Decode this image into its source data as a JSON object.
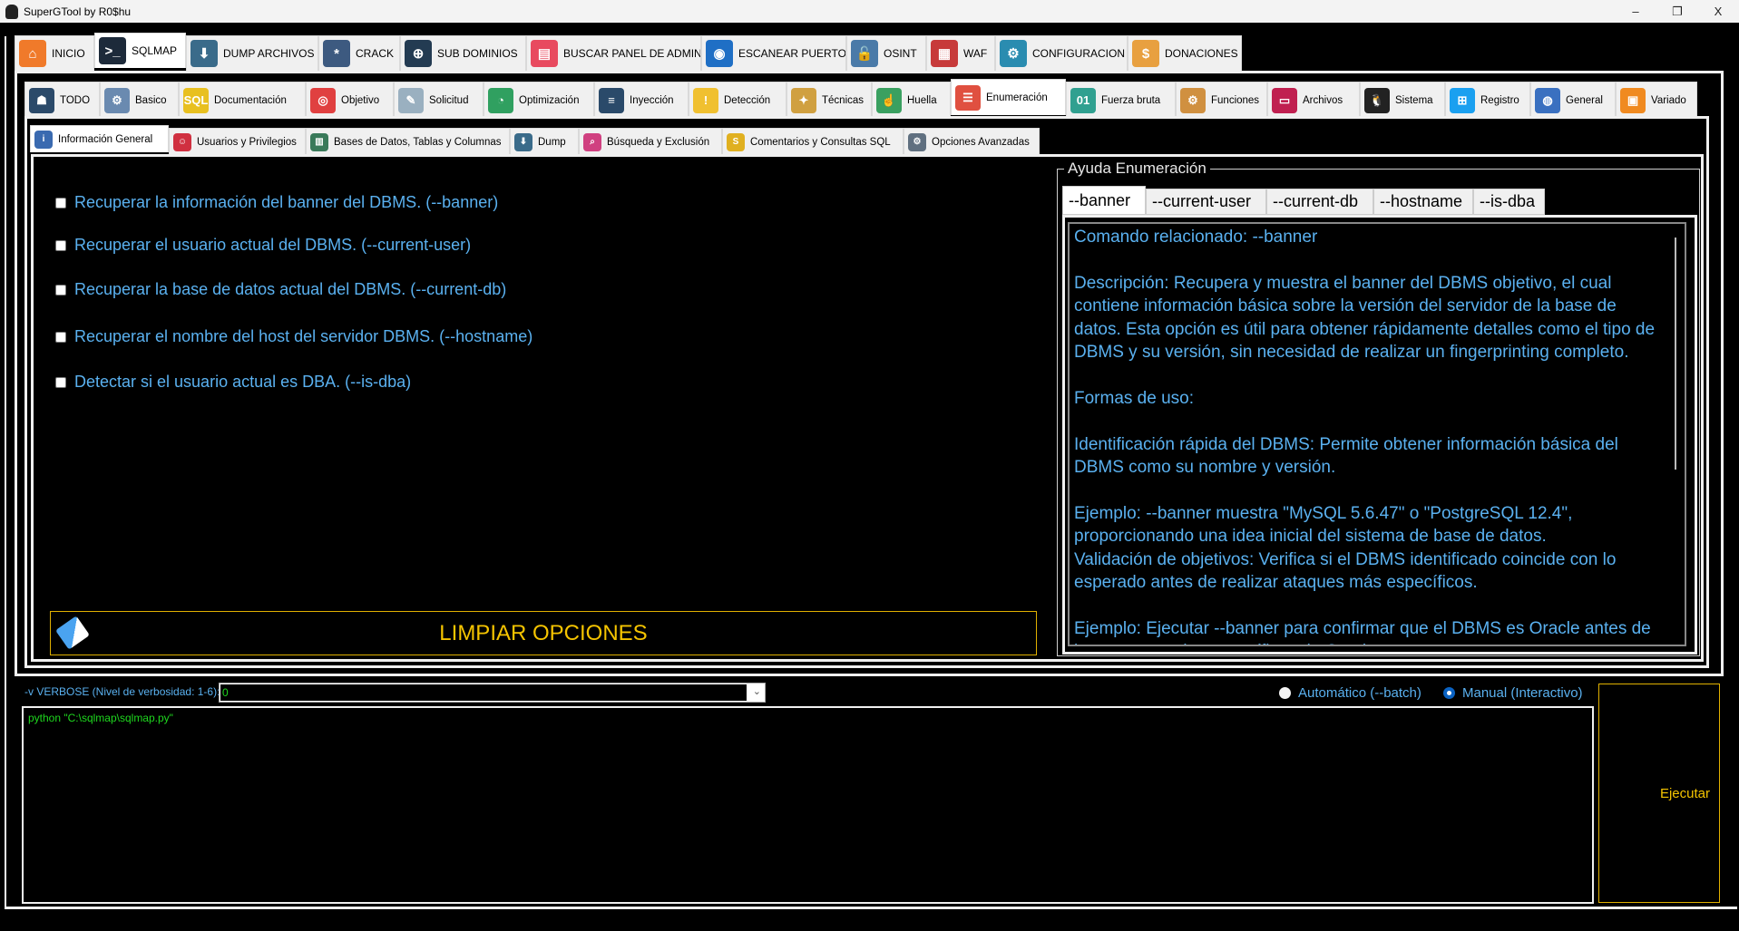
{
  "window": {
    "title": "SuperGTool by R0$hu",
    "minimize": "–",
    "maximize": "❐",
    "close": "X"
  },
  "main_tabs": [
    {
      "label": "INICIO",
      "icon": "home-icon",
      "color": "#f07a2a",
      "glyph": "⌂"
    },
    {
      "label": "SQLMAP",
      "icon": "terminal-icon",
      "color": "#1d2a3a",
      "glyph": ">_",
      "active": true
    },
    {
      "label": "DUMP ARCHIVOS",
      "icon": "database-download-icon",
      "color": "#3a6b8a",
      "glyph": "⬇"
    },
    {
      "label": "CRACK",
      "icon": "password-icon",
      "color": "#3d5a80",
      "glyph": "*"
    },
    {
      "label": "SUB DOMINIOS",
      "icon": "network-globe-icon",
      "color": "#233b52",
      "glyph": "⊕"
    },
    {
      "label": "BUSCAR PANEL DE ADMIN",
      "icon": "admin-panel-icon",
      "color": "#e84a5f",
      "glyph": "▤"
    },
    {
      "label": "ESCANEAR PUERTOS",
      "icon": "port-scan-icon",
      "color": "#1f6fc5",
      "glyph": "◉"
    },
    {
      "label": "OSINT",
      "icon": "unlock-icon",
      "color": "#4a7aa8",
      "glyph": "🔓"
    },
    {
      "label": "WAF",
      "icon": "firewall-icon",
      "color": "#c73a3a",
      "glyph": "▦"
    },
    {
      "label": "CONFIGURACION",
      "icon": "gear-icon",
      "color": "#2a8cb0",
      "glyph": "⚙"
    },
    {
      "label": "DONACIONES",
      "icon": "donate-icon",
      "color": "#e8a040",
      "glyph": "$"
    }
  ],
  "sub_tabs": [
    {
      "label": "TODO",
      "icon": "hacker-icon",
      "color": "#2b4a6a",
      "glyph": "☗"
    },
    {
      "label": "Basico",
      "icon": "robot-icon",
      "color": "#6a8ab0",
      "glyph": "⚙"
    },
    {
      "label": "Documentación",
      "icon": "sql-document-icon",
      "color": "#e8c020",
      "glyph": "SQL"
    },
    {
      "label": "Objetivo",
      "icon": "target-icon",
      "color": "#e04040",
      "glyph": "◎"
    },
    {
      "label": "Solicitud",
      "icon": "request-icon",
      "color": "#9ab0c0",
      "glyph": "✎"
    },
    {
      "label": "Optimización",
      "icon": "speedometer-icon",
      "color": "#30a060",
      "glyph": "◔"
    },
    {
      "label": "Inyección",
      "icon": "database-inject-icon",
      "color": "#2a4a6a",
      "glyph": "≡"
    },
    {
      "label": "Detección",
      "icon": "warning-search-icon",
      "color": "#f0c030",
      "glyph": "!"
    },
    {
      "label": "Técnicas",
      "icon": "lightbulb-gear-icon",
      "color": "#d0a040",
      "glyph": "✦"
    },
    {
      "label": "Huella",
      "icon": "fingerprint-icon",
      "color": "#3aa060",
      "glyph": "☝"
    },
    {
      "label": "Enumeración",
      "icon": "server-user-icon",
      "color": "#e05040",
      "glyph": "☰",
      "active": true
    },
    {
      "label": "Fuerza bruta",
      "icon": "binary-chat-icon",
      "color": "#30a090",
      "glyph": "01"
    },
    {
      "label": "Funciones",
      "icon": "brain-gear-icon",
      "color": "#d09040",
      "glyph": "⚙"
    },
    {
      "label": "Archivos",
      "icon": "file-icon",
      "color": "#c02050",
      "glyph": "▭"
    },
    {
      "label": "Sistema",
      "icon": "linux-icon",
      "color": "#222222",
      "glyph": "🐧"
    },
    {
      "label": "Registro",
      "icon": "windows-icon",
      "color": "#1aa0f0",
      "glyph": "⊞"
    },
    {
      "label": "General",
      "icon": "globe-cycle-icon",
      "color": "#3a70c0",
      "glyph": "◍"
    },
    {
      "label": "Variado",
      "icon": "toolbox-icon",
      "color": "#f08a20",
      "glyph": "▣"
    }
  ],
  "third_tabs": [
    {
      "label": "Información General",
      "icon": "search-info-icon",
      "color": "#3a6ab0",
      "glyph": "i",
      "active": true
    },
    {
      "label": "Usuarios y Privilegios",
      "icon": "user-privilege-icon",
      "color": "#d03040",
      "glyph": "☺"
    },
    {
      "label": "Bases de Datos, Tablas y Columnas",
      "icon": "database-tree-icon",
      "color": "#3a7a5a",
      "glyph": "▥"
    },
    {
      "label": "Dump",
      "icon": "database-download-icon",
      "color": "#3a6b8a",
      "glyph": "⬇"
    },
    {
      "label": "Búsqueda y Exclusión",
      "icon": "search-window-icon",
      "color": "#d04080",
      "glyph": "⌕"
    },
    {
      "label": "Comentarios y Consultas SQL",
      "icon": "sql-database-icon",
      "color": "#e0b020",
      "glyph": "S"
    },
    {
      "label": "Opciones Avanzadas",
      "icon": "chip-gear-icon",
      "color": "#607080",
      "glyph": "⚙"
    }
  ],
  "options": [
    {
      "label": "Recuperar la información del banner del DBMS. (--banner)",
      "checked": false
    },
    {
      "label": "Recuperar el usuario actual del DBMS. (--current-user)",
      "checked": false
    },
    {
      "label": "Recuperar la base de datos actual del DBMS. (--current-db)",
      "checked": false
    },
    {
      "label": "Recuperar el nombre del host del servidor DBMS. (--hostname)",
      "checked": false
    },
    {
      "label": "Detectar si el usuario actual es DBA. (--is-dba)",
      "checked": false
    }
  ],
  "clear_button": {
    "label": "LIMPIAR OPCIONES",
    "icon": "eraser-icon"
  },
  "help": {
    "legend": "Ayuda Enumeración",
    "tabs": [
      "--banner",
      "--current-user",
      "--current-db",
      "--hostname",
      "--is-dba"
    ],
    "text": "Comando relacionado: --banner\n\nDescripción: Recupera y muestra el banner del DBMS objetivo, el cual contiene información básica sobre la versión del servidor de la base de datos. Esta opción es útil para obtener rápidamente detalles como el tipo de DBMS y su versión, sin necesidad de realizar un fingerprinting completo.\n\nFormas de uso:\n\nIdentificación rápida del DBMS: Permite obtener información básica del DBMS como su nombre y versión.\n\nEjemplo: --banner muestra \"MySQL 5.6.47\" o \"PostgreSQL 12.4\", proporcionando una idea inicial del sistema de base de datos.\nValidación de objetivos: Verifica si el DBMS identificado coincide con lo esperado antes de realizar ataques más específicos.\n\nEjemplo: Ejecutar --banner para confirmar que el DBMS es Oracle antes de lanzar comandos específicos de Oracle."
  },
  "verbose": {
    "label": "-v VERBOSE (Nivel de verbosidad: 1-6):",
    "value": "0"
  },
  "mode": {
    "auto_label": "Automático (--batch)",
    "manual_label": "Manual (Interactivo)",
    "selected": "manual"
  },
  "command": "python \"C:\\sqlmap\\sqlmap.py\"",
  "execute_label": "Ejecutar",
  "colors": {
    "text_blue": "#5ab1f0",
    "accent_yellow": "#f5c400",
    "command_green": "#1ed81e"
  }
}
